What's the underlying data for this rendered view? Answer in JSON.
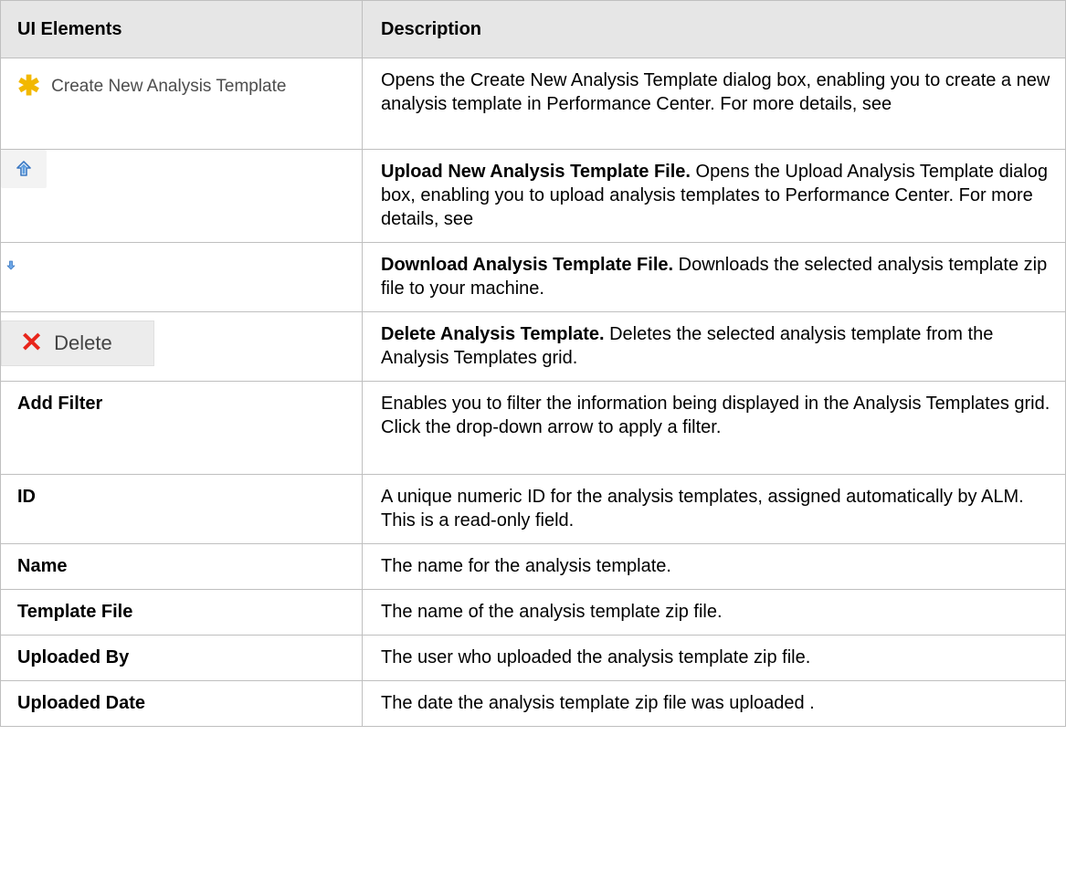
{
  "header": {
    "col1": "UI Elements",
    "col2": "Description"
  },
  "rows": [
    {
      "element": "Create New Analysis Template",
      "element_icon": "asterisk-icon",
      "description_bold": "",
      "description": "Opens the Create New Analysis Template dialog box, enabling you to create a new analysis template in Performance Center. For more details, see"
    },
    {
      "element": "",
      "element_icon": "upload-arrow-icon",
      "description_bold": "Upload New Analysis Template File.",
      "description": " Opens the Upload Analysis Template dialog box, enabling you to upload analysis templates to Performance Center. For more details, see"
    },
    {
      "element": "",
      "element_icon": "download-arrow-icon",
      "description_bold": "Download Analysis Template File.",
      "description": " Downloads the selected analysis template zip file to your machine."
    },
    {
      "element": "Delete",
      "element_icon": "delete-x-icon",
      "description_bold": "Delete Analysis Template.",
      "description": " Deletes the selected analysis template from the Analysis Templates grid."
    },
    {
      "element": "Add Filter",
      "description": "Enables you to filter the information being displayed in the Analysis Templates grid. Click the drop-down arrow to apply a filter."
    },
    {
      "element": "ID",
      "description": "A unique numeric ID for the analysis templates, assigned automatically by ALM. This is a read-only field."
    },
    {
      "element": "Name",
      "description": "The name for the analysis template."
    },
    {
      "element": "Template File",
      "description": "The name of the analysis template zip file."
    },
    {
      "element": "Uploaded By",
      "description": "The user who uploaded the analysis template zip file."
    },
    {
      "element": "Uploaded Date",
      "description": "The date the analysis template zip file was uploaded ."
    }
  ],
  "colors": {
    "header_bg": "#e6e6e6",
    "border": "#bfbfbf",
    "asterisk": "#f2b800",
    "delete_x": "#e8251b",
    "upload_arrow": "#3a78c2"
  }
}
